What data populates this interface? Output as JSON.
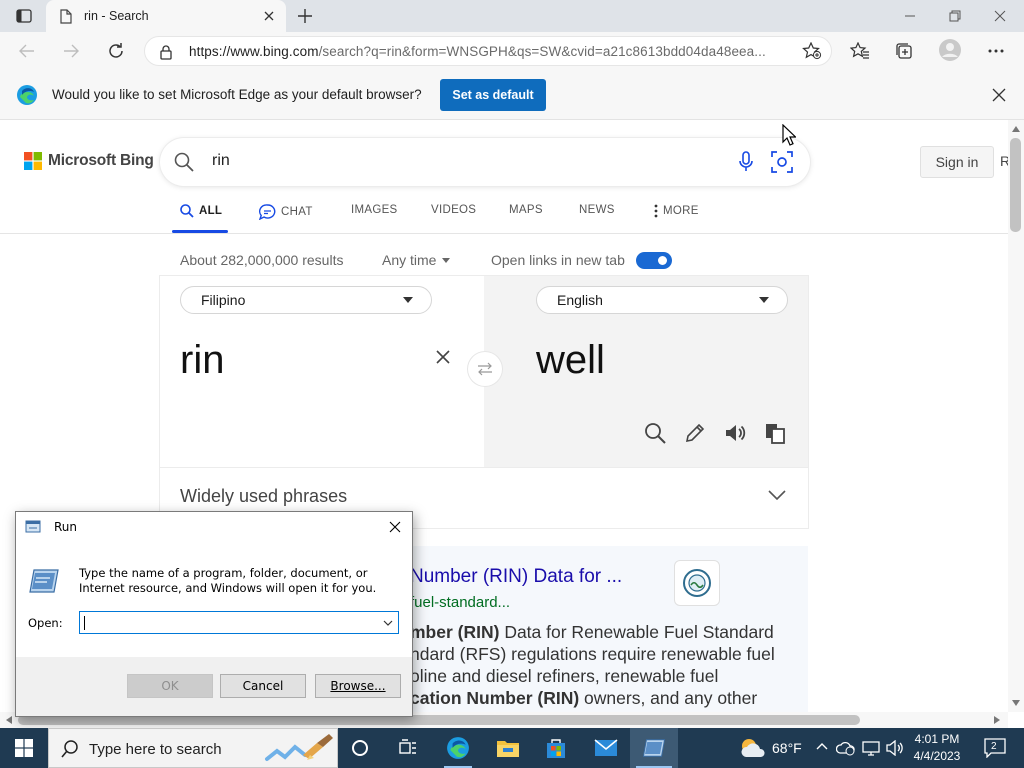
{
  "browser": {
    "tab_title": "rin - Search",
    "url_prefix": "https://www.bing.com",
    "url_rest": "/search?q=rin&form=WNSGPH&qs=SW&cvid=a21c8613bdd04da48eea..."
  },
  "infobar": {
    "message": "Would you like to set Microsoft Edge as your default browser?",
    "button": "Set as default"
  },
  "bing": {
    "logo_text": "Microsoft Bing",
    "query": "rin",
    "sign_in": "Sign in",
    "sign_in_extra": "R",
    "scopes": [
      {
        "label": "ALL",
        "icon": "search-icon"
      },
      {
        "label": "CHAT",
        "icon": "chat-icon"
      },
      {
        "label": "IMAGES"
      },
      {
        "label": "VIDEOS"
      },
      {
        "label": "MAPS"
      },
      {
        "label": "NEWS"
      },
      {
        "label": "MORE",
        "icon": "more-vertical-icon"
      }
    ],
    "results_count": "About 282,000,000 results",
    "time_filter": "Any time",
    "open_links_label": "Open links in new tab",
    "open_links_enabled": true
  },
  "translator": {
    "source_lang": "Filipino",
    "target_lang": "English",
    "source_text": "rin",
    "target_text": "well",
    "phrases_title": "Widely used phrases"
  },
  "result": {
    "title": "Number (RIN) Data for ...",
    "url": "fuel-standard...",
    "snippet_lines": [
      {
        "bold": "mber (RIN)",
        "rest": " Data for Renewable Fuel Standard"
      },
      {
        "bold": "",
        "rest": "ndard (RFS) regulations require renewable fuel"
      },
      {
        "bold": "",
        "rest": "oline and diesel refiners, renewable fuel"
      },
      {
        "bold": "cation Number (RIN)",
        "rest": " owners, and any other"
      }
    ]
  },
  "run_dialog": {
    "title": "Run",
    "description": "Type the name of a program, folder, document, or Internet resource, and Windows will open it for you.",
    "open_label": "Open:",
    "open_value": "",
    "ok": "OK",
    "cancel": "Cancel",
    "browse": "Browse..."
  },
  "taskbar": {
    "search_placeholder": "Type here to search",
    "weather": "68°F",
    "time": "4:01 PM",
    "date": "4/4/2023",
    "notification_count": "2"
  },
  "colors": {
    "accent": "#0f6cbd",
    "bing_active": "#174ae4",
    "link": "#1a0dab",
    "url_green": "#006d21",
    "taskbar": "#1f3a52"
  }
}
